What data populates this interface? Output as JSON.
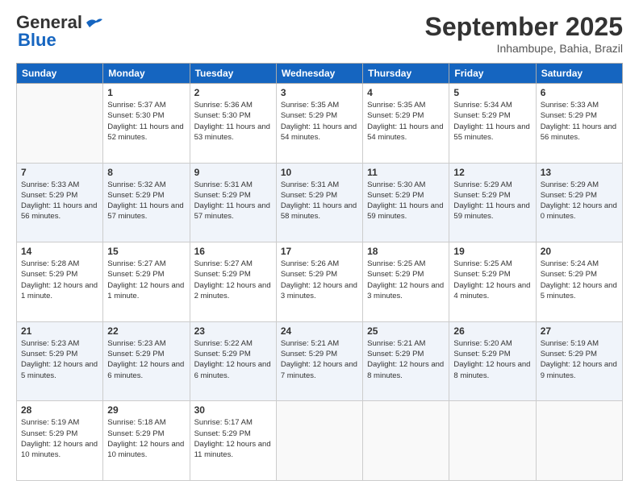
{
  "header": {
    "logo_general": "General",
    "logo_blue": "Blue",
    "month": "September 2025",
    "location": "Inhambupe, Bahia, Brazil"
  },
  "days_of_week": [
    "Sunday",
    "Monday",
    "Tuesday",
    "Wednesday",
    "Thursday",
    "Friday",
    "Saturday"
  ],
  "weeks": [
    [
      {
        "day": "",
        "sunrise": "",
        "sunset": "",
        "daylight": ""
      },
      {
        "day": "1",
        "sunrise": "Sunrise: 5:37 AM",
        "sunset": "Sunset: 5:30 PM",
        "daylight": "Daylight: 11 hours and 52 minutes."
      },
      {
        "day": "2",
        "sunrise": "Sunrise: 5:36 AM",
        "sunset": "Sunset: 5:30 PM",
        "daylight": "Daylight: 11 hours and 53 minutes."
      },
      {
        "day": "3",
        "sunrise": "Sunrise: 5:35 AM",
        "sunset": "Sunset: 5:29 PM",
        "daylight": "Daylight: 11 hours and 54 minutes."
      },
      {
        "day": "4",
        "sunrise": "Sunrise: 5:35 AM",
        "sunset": "Sunset: 5:29 PM",
        "daylight": "Daylight: 11 hours and 54 minutes."
      },
      {
        "day": "5",
        "sunrise": "Sunrise: 5:34 AM",
        "sunset": "Sunset: 5:29 PM",
        "daylight": "Daylight: 11 hours and 55 minutes."
      },
      {
        "day": "6",
        "sunrise": "Sunrise: 5:33 AM",
        "sunset": "Sunset: 5:29 PM",
        "daylight": "Daylight: 11 hours and 56 minutes."
      }
    ],
    [
      {
        "day": "7",
        "sunrise": "Sunrise: 5:33 AM",
        "sunset": "Sunset: 5:29 PM",
        "daylight": "Daylight: 11 hours and 56 minutes."
      },
      {
        "day": "8",
        "sunrise": "Sunrise: 5:32 AM",
        "sunset": "Sunset: 5:29 PM",
        "daylight": "Daylight: 11 hours and 57 minutes."
      },
      {
        "day": "9",
        "sunrise": "Sunrise: 5:31 AM",
        "sunset": "Sunset: 5:29 PM",
        "daylight": "Daylight: 11 hours and 57 minutes."
      },
      {
        "day": "10",
        "sunrise": "Sunrise: 5:31 AM",
        "sunset": "Sunset: 5:29 PM",
        "daylight": "Daylight: 11 hours and 58 minutes."
      },
      {
        "day": "11",
        "sunrise": "Sunrise: 5:30 AM",
        "sunset": "Sunset: 5:29 PM",
        "daylight": "Daylight: 11 hours and 59 minutes."
      },
      {
        "day": "12",
        "sunrise": "Sunrise: 5:29 AM",
        "sunset": "Sunset: 5:29 PM",
        "daylight": "Daylight: 11 hours and 59 minutes."
      },
      {
        "day": "13",
        "sunrise": "Sunrise: 5:29 AM",
        "sunset": "Sunset: 5:29 PM",
        "daylight": "Daylight: 12 hours and 0 minutes."
      }
    ],
    [
      {
        "day": "14",
        "sunrise": "Sunrise: 5:28 AM",
        "sunset": "Sunset: 5:29 PM",
        "daylight": "Daylight: 12 hours and 1 minute."
      },
      {
        "day": "15",
        "sunrise": "Sunrise: 5:27 AM",
        "sunset": "Sunset: 5:29 PM",
        "daylight": "Daylight: 12 hours and 1 minute."
      },
      {
        "day": "16",
        "sunrise": "Sunrise: 5:27 AM",
        "sunset": "Sunset: 5:29 PM",
        "daylight": "Daylight: 12 hours and 2 minutes."
      },
      {
        "day": "17",
        "sunrise": "Sunrise: 5:26 AM",
        "sunset": "Sunset: 5:29 PM",
        "daylight": "Daylight: 12 hours and 3 minutes."
      },
      {
        "day": "18",
        "sunrise": "Sunrise: 5:25 AM",
        "sunset": "Sunset: 5:29 PM",
        "daylight": "Daylight: 12 hours and 3 minutes."
      },
      {
        "day": "19",
        "sunrise": "Sunrise: 5:25 AM",
        "sunset": "Sunset: 5:29 PM",
        "daylight": "Daylight: 12 hours and 4 minutes."
      },
      {
        "day": "20",
        "sunrise": "Sunrise: 5:24 AM",
        "sunset": "Sunset: 5:29 PM",
        "daylight": "Daylight: 12 hours and 5 minutes."
      }
    ],
    [
      {
        "day": "21",
        "sunrise": "Sunrise: 5:23 AM",
        "sunset": "Sunset: 5:29 PM",
        "daylight": "Daylight: 12 hours and 5 minutes."
      },
      {
        "day": "22",
        "sunrise": "Sunrise: 5:23 AM",
        "sunset": "Sunset: 5:29 PM",
        "daylight": "Daylight: 12 hours and 6 minutes."
      },
      {
        "day": "23",
        "sunrise": "Sunrise: 5:22 AM",
        "sunset": "Sunset: 5:29 PM",
        "daylight": "Daylight: 12 hours and 6 minutes."
      },
      {
        "day": "24",
        "sunrise": "Sunrise: 5:21 AM",
        "sunset": "Sunset: 5:29 PM",
        "daylight": "Daylight: 12 hours and 7 minutes."
      },
      {
        "day": "25",
        "sunrise": "Sunrise: 5:21 AM",
        "sunset": "Sunset: 5:29 PM",
        "daylight": "Daylight: 12 hours and 8 minutes."
      },
      {
        "day": "26",
        "sunrise": "Sunrise: 5:20 AM",
        "sunset": "Sunset: 5:29 PM",
        "daylight": "Daylight: 12 hours and 8 minutes."
      },
      {
        "day": "27",
        "sunrise": "Sunrise: 5:19 AM",
        "sunset": "Sunset: 5:29 PM",
        "daylight": "Daylight: 12 hours and 9 minutes."
      }
    ],
    [
      {
        "day": "28",
        "sunrise": "Sunrise: 5:19 AM",
        "sunset": "Sunset: 5:29 PM",
        "daylight": "Daylight: 12 hours and 10 minutes."
      },
      {
        "day": "29",
        "sunrise": "Sunrise: 5:18 AM",
        "sunset": "Sunset: 5:29 PM",
        "daylight": "Daylight: 12 hours and 10 minutes."
      },
      {
        "day": "30",
        "sunrise": "Sunrise: 5:17 AM",
        "sunset": "Sunset: 5:29 PM",
        "daylight": "Daylight: 12 hours and 11 minutes."
      },
      {
        "day": "",
        "sunrise": "",
        "sunset": "",
        "daylight": ""
      },
      {
        "day": "",
        "sunrise": "",
        "sunset": "",
        "daylight": ""
      },
      {
        "day": "",
        "sunrise": "",
        "sunset": "",
        "daylight": ""
      },
      {
        "day": "",
        "sunrise": "",
        "sunset": "",
        "daylight": ""
      }
    ]
  ]
}
